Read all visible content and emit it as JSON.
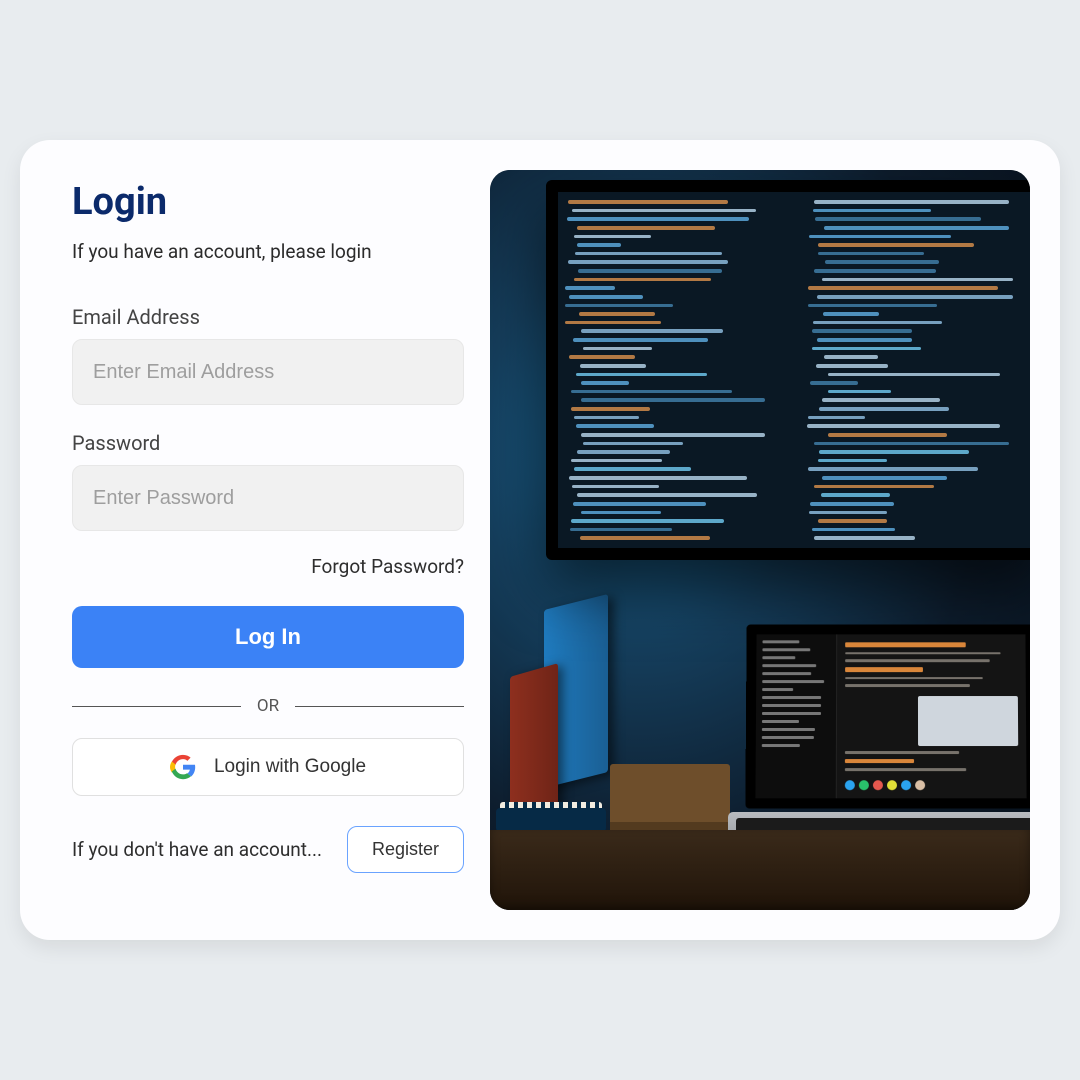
{
  "login": {
    "title": "Login",
    "subtitle": "If you have an account, please login",
    "email_label": "Email Address",
    "email_placeholder": "Enter Email Address",
    "password_label": "Password",
    "password_placeholder": "Enter Password",
    "forgot": "Forgot Password?",
    "login_button": "Log In",
    "divider": "OR",
    "google_button": "Login with Google",
    "register_text": "If you don't have an account...",
    "register_button": "Register"
  },
  "image": {
    "semantic": "desk-code-photo"
  }
}
